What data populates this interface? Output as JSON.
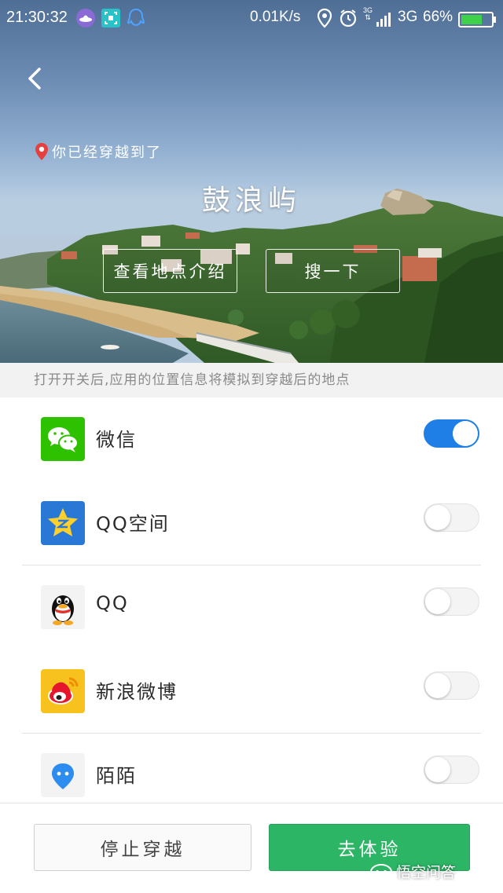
{
  "status_bar": {
    "time": "21:30:32",
    "net_speed": "0.01K/s",
    "network": "3G",
    "battery": "66%",
    "small_network_label": "3G",
    "icons": [
      "ufo-app-icon",
      "scan-app-icon",
      "qq-notification-icon",
      "location-icon",
      "alarm-icon",
      "data-arrows-icon",
      "signal-icon",
      "battery-icon"
    ]
  },
  "hero": {
    "hint": "你已经穿越到了",
    "place_name": "鼓浪屿",
    "btn_intro": "查看地点介绍",
    "btn_search": "搜一下"
  },
  "notice": "打开开关后,应用的位置信息将模拟到穿越后的地点",
  "apps": [
    {
      "name": "微信",
      "icon": "wechat-icon",
      "enabled": true
    },
    {
      "name": "QQ空间",
      "icon": "qzone-icon",
      "enabled": false
    },
    {
      "name": "QQ",
      "icon": "qq-icon",
      "enabled": false
    },
    {
      "name": "新浪微博",
      "icon": "weibo-icon",
      "enabled": false
    },
    {
      "name": "陌陌",
      "icon": "momo-icon",
      "enabled": false
    }
  ],
  "bottom": {
    "stop_label": "停止穿越",
    "go_label": "去体验"
  },
  "watermark": "悟空问答",
  "colors": {
    "toggle_on": "#1f7fe7",
    "go_button": "#2db566",
    "wechat_green": "#2dc100",
    "qzone_blue": "#2a78d6",
    "weibo_yellow": "#f7c11e"
  }
}
